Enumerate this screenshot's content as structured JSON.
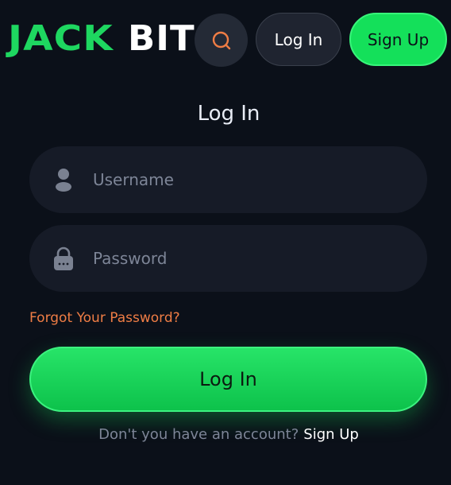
{
  "header": {
    "logo_part1": "JACK",
    "logo_part2": "BIT",
    "login_label": "Log In",
    "signup_label": "Sign Up"
  },
  "form": {
    "title": "Log In",
    "username_placeholder": "Username",
    "password_placeholder": "Password",
    "forgot_label": "Forgot Your Password?",
    "submit_label": "Log In",
    "no_account_text": "Don't you have an account?",
    "signup_link": "Sign Up"
  },
  "colors": {
    "brand_green": "#14e05a",
    "accent_orange": "#ef7d45",
    "background": "#0b1019"
  },
  "icons": {
    "search": "search-icon",
    "user": "user-icon",
    "lock": "lock-icon"
  }
}
